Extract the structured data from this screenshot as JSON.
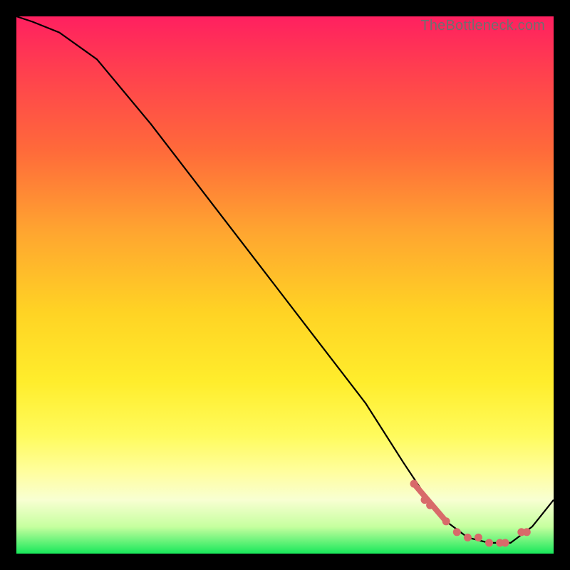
{
  "watermark": "TheBottleneck.com",
  "chart_data": {
    "type": "line",
    "title": "",
    "xlabel": "",
    "ylabel": "",
    "xlim": [
      0,
      100
    ],
    "ylim": [
      0,
      100
    ],
    "x": [
      0,
      3,
      8,
      15,
      25,
      35,
      45,
      55,
      65,
      72,
      76,
      80,
      84,
      88,
      92,
      96,
      100
    ],
    "y": [
      100,
      99,
      97,
      92,
      80,
      67,
      54,
      41,
      28,
      17,
      11,
      6,
      3,
      2,
      2,
      5,
      10
    ],
    "highlight_points_x": [
      74,
      76,
      77,
      80,
      82,
      84,
      86,
      88,
      90,
      91,
      94,
      95
    ],
    "highlight_points_y": [
      13,
      10,
      9,
      6,
      4,
      3,
      3,
      2,
      2,
      2,
      4,
      4
    ],
    "highlight_segment": {
      "x0": 74,
      "y0": 13,
      "x1": 80,
      "y1": 6
    },
    "colors": {
      "curve": "#000000",
      "dots": "#d86a6a",
      "gradient_top": "#ff2060",
      "gradient_bottom": "#18e85a"
    }
  }
}
